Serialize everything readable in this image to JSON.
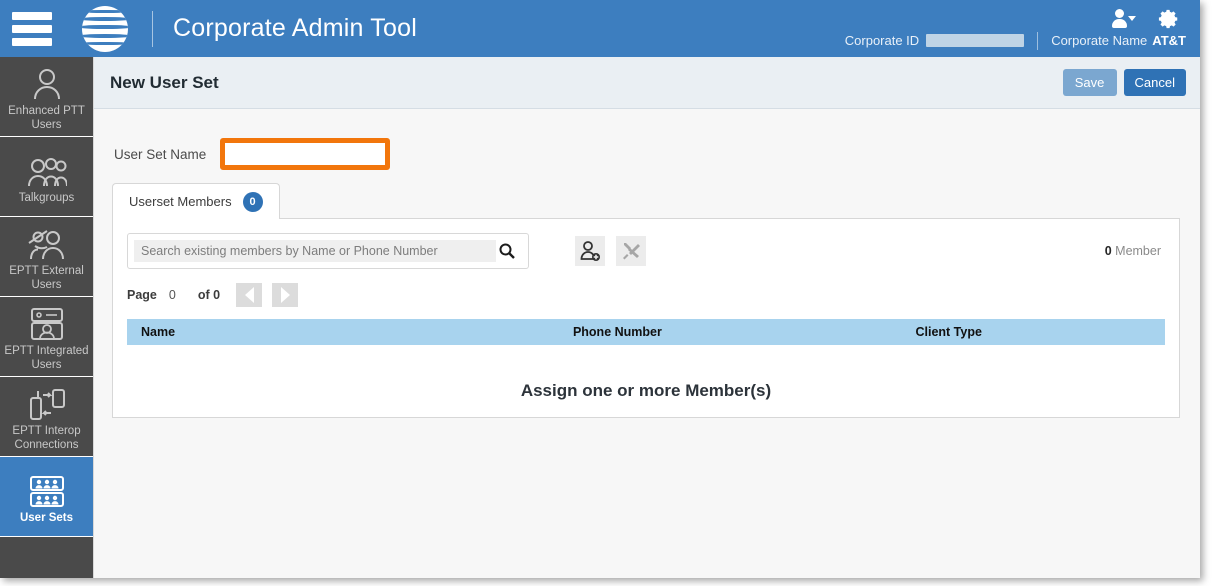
{
  "header": {
    "title": "Corporate Admin Tool",
    "menu_icon": "hamburger-icon",
    "logo_icon": "att-globe-logo",
    "user_icon": "user-account-icon",
    "settings_icon": "gear-icon",
    "corporate_id_label": "Corporate ID",
    "corporate_id_value": "",
    "corporate_name_label": "Corporate Name",
    "corporate_name_value": "AT&T",
    "bar_color": "#3d7ebf"
  },
  "sidebar": {
    "items": [
      {
        "label": "Enhanced PTT Users",
        "icon": "single-user-icon",
        "active": false
      },
      {
        "label": "Talkgroups",
        "icon": "group-users-icon",
        "active": false
      },
      {
        "label": "EPTT External Users",
        "icon": "external-user-icon",
        "active": false
      },
      {
        "label": "EPTT Integrated Users",
        "icon": "integrated-user-icon",
        "active": false
      },
      {
        "label": "EPTT Interop Connections",
        "icon": "interop-radio-phone-icon",
        "active": false
      },
      {
        "label": "User Sets",
        "icon": "user-sets-icon",
        "active": true
      }
    ],
    "active_color": "#3d7ebf"
  },
  "page": {
    "title": "New User Set",
    "save_label": "Save",
    "cancel_label": "Cancel",
    "save_enabled": false
  },
  "form": {
    "user_set_name_label": "User Set Name",
    "user_set_name_value": "",
    "user_set_name_placeholder": "",
    "highlight_color": "#f2760c"
  },
  "panel": {
    "tab_label": "Userset Members",
    "tab_badge": "0",
    "search_placeholder": "Search existing members by Name or Phone Number",
    "search_value": "",
    "search_icon": "magnifier-icon",
    "add_member_icon": "add-member-icon",
    "tools_icon": "tools-icon",
    "member_count_number": "0",
    "member_count_label": "Member",
    "pagination": {
      "page_label": "Page",
      "page_value": "0",
      "of_label": "of 0",
      "prev_icon": "prev-page-icon",
      "next_icon": "next-page-icon"
    },
    "table": {
      "columns": [
        "Name",
        "Phone Number",
        "Client Type"
      ],
      "rows": [],
      "empty_message": "Assign one or more Member(s)",
      "header_color": "#a8d3ee"
    }
  }
}
